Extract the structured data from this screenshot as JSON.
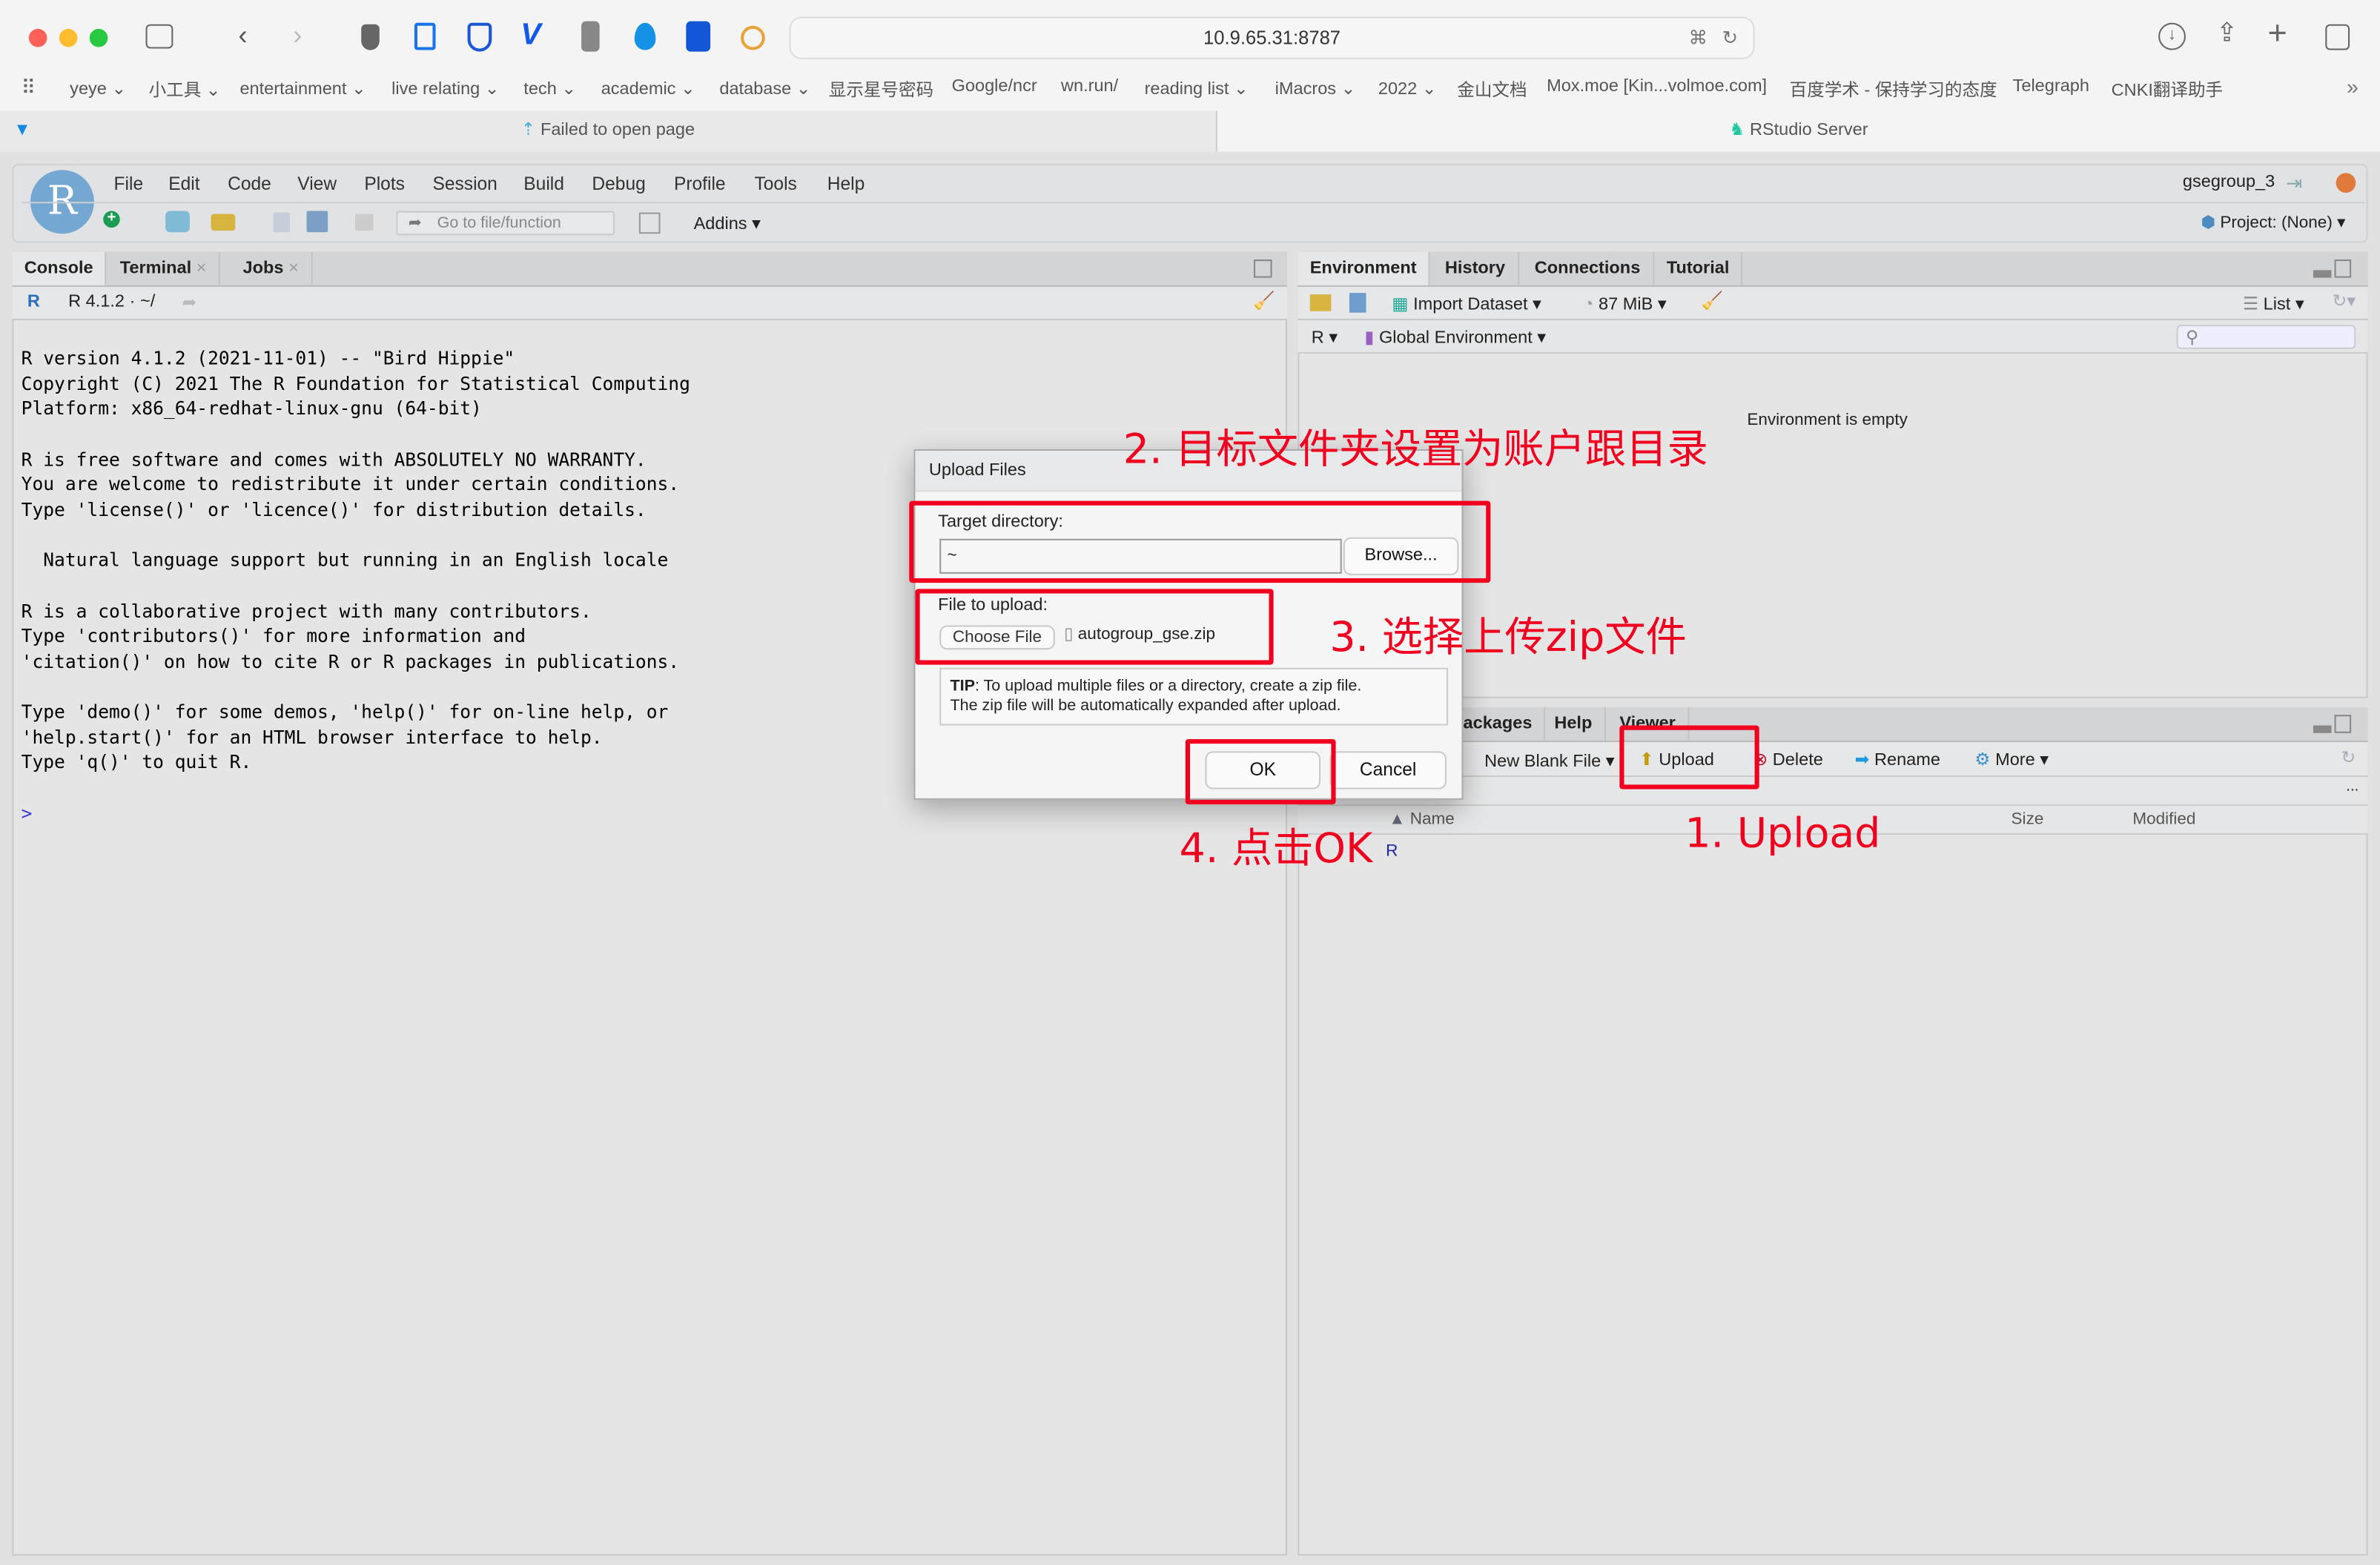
{
  "browser": {
    "url": "10.9.65.31:8787",
    "bookmarks": [
      "yeye ⌄",
      "小工具 ⌄",
      "entertainment ⌄",
      "live relating ⌄",
      "tech ⌄",
      "academic ⌄",
      "database ⌄",
      "显示星号密码",
      "Google/ncr",
      "wn.run/",
      "reading list ⌄",
      "iMacros ⌄",
      "2022 ⌄",
      "金山文档",
      "Mox.moe [Kin...volmoe.com]",
      "百度学术 - 保持学习的态度",
      "Telegraph",
      "CNKI翻译助手"
    ],
    "tabs": [
      {
        "label": "Failed to open page",
        "active": false
      },
      {
        "label": "RStudio Server",
        "active": true
      }
    ]
  },
  "rstudio": {
    "menu": [
      "File",
      "Edit",
      "Code",
      "View",
      "Plots",
      "Session",
      "Build",
      "Debug",
      "Profile",
      "Tools",
      "Help"
    ],
    "goto_placeholder": "Go to file/function",
    "addins": "Addins",
    "user": "gsegroup_3",
    "project": "Project: (None)",
    "left_tabs": [
      "Console",
      "Terminal",
      "Jobs"
    ],
    "r_version": "R 4.1.2 · ~/",
    "console_lines": [
      "R version 4.1.2 (2021-11-01) -- \"Bird Hippie\"",
      "Copyright (C) 2021 The R Foundation for Statistical Computing",
      "Platform: x86_64-redhat-linux-gnu (64-bit)",
      "",
      "R is free software and comes with ABSOLUTELY NO WARRANTY.",
      "You are welcome to redistribute it under certain conditions.",
      "Type 'license()' or 'licence()' for distribution details.",
      "",
      "  Natural language support but running in an English locale",
      "",
      "R is a collaborative project with many contributors.",
      "Type 'contributors()' for more information and",
      "'citation()' on how to cite R or R packages in publications.",
      "",
      "Type 'demo()' for some demos, 'help()' for on-line help, or",
      "'help.start()' for an HTML browser interface to help.",
      "Type 'q()' to quit R.",
      "",
      ">"
    ],
    "env_tabs": [
      "Environment",
      "History",
      "Connections",
      "Tutorial"
    ],
    "env_toolbar": {
      "import": "Import Dataset",
      "memory": "87 MiB",
      "list": "List"
    },
    "env_lang": "R",
    "env_scope": "Global Environment",
    "env_empty": "Environment is empty",
    "files_tabs": [
      "ackages",
      "Help",
      "Viewer"
    ],
    "files_toolbar": {
      "new": "New Blank File",
      "upload": "Upload",
      "delete": "Delete",
      "rename": "Rename",
      "more": "More"
    },
    "files_columns": {
      "name": "Name",
      "size": "Size",
      "modified": "Modified"
    },
    "files_row": "R"
  },
  "dialog": {
    "title": "Upload Files",
    "target_label": "Target directory:",
    "target_value": "~",
    "browse": "Browse...",
    "file_label": "File to upload:",
    "choose": "Choose File",
    "file_name": "autogroup_gse.zip",
    "tip_bold": "TIP",
    "tip_line1": ": To upload multiple files or a directory, create a zip file.",
    "tip_line2": "The zip file will be automatically expanded after upload.",
    "ok": "OK",
    "cancel": "Cancel"
  },
  "annotations": {
    "step1": "1. Upload",
    "step2": "2. 目标文件夹设置为账户跟目录",
    "step3": "3. 选择上传zip文件",
    "step4": "4. 点击OK",
    "color": "#f0001e"
  }
}
